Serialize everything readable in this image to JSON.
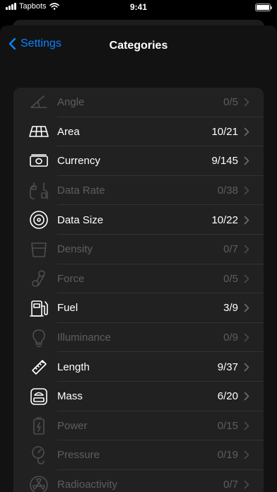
{
  "status": {
    "carrier": "Tapbots",
    "time": "9:41"
  },
  "nav": {
    "back_label": "Settings",
    "title": "Categories"
  },
  "colors": {
    "accent": "#0a84ff",
    "background": "#121212",
    "card": "#212121"
  },
  "categories": [
    {
      "label": "Angle",
      "value": "0/5",
      "icon": "angle-icon",
      "enabled": false
    },
    {
      "label": "Area",
      "value": "10/21",
      "icon": "area-icon",
      "enabled": true
    },
    {
      "label": "Currency",
      "value": "9/145",
      "icon": "currency-icon",
      "enabled": true
    },
    {
      "label": "Data Rate",
      "value": "0/38",
      "icon": "data-rate-icon",
      "enabled": false
    },
    {
      "label": "Data Size",
      "value": "10/22",
      "icon": "data-size-icon",
      "enabled": true
    },
    {
      "label": "Density",
      "value": "0/7",
      "icon": "density-icon",
      "enabled": false
    },
    {
      "label": "Force",
      "value": "0/5",
      "icon": "force-icon",
      "enabled": false
    },
    {
      "label": "Fuel",
      "value": "3/9",
      "icon": "fuel-icon",
      "enabled": true
    },
    {
      "label": "Illuminance",
      "value": "0/9",
      "icon": "illuminance-icon",
      "enabled": false
    },
    {
      "label": "Length",
      "value": "9/37",
      "icon": "length-icon",
      "enabled": true
    },
    {
      "label": "Mass",
      "value": "6/20",
      "icon": "mass-icon",
      "enabled": true
    },
    {
      "label": "Power",
      "value": "0/15",
      "icon": "power-icon",
      "enabled": false
    },
    {
      "label": "Pressure",
      "value": "0/19",
      "icon": "pressure-icon",
      "enabled": false
    },
    {
      "label": "Radioactivity",
      "value": "0/7",
      "icon": "radioactivity-icon",
      "enabled": false
    }
  ]
}
